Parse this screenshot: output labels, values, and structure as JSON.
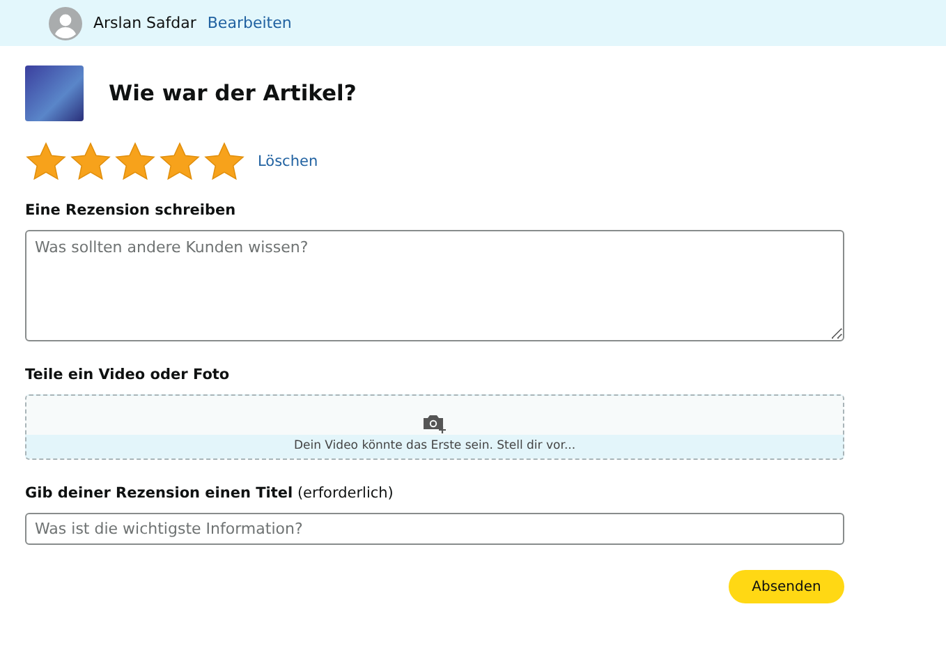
{
  "header": {
    "user_name": "Arslan Safdar",
    "edit_link": "Bearbeiten"
  },
  "product": {
    "heading": "Wie war der Artikel?"
  },
  "rating": {
    "stars": 5,
    "clear_link": "Löschen"
  },
  "review": {
    "label": "Eine Rezension schreiben",
    "placeholder": "Was sollten andere Kunden wissen?"
  },
  "media": {
    "label": "Teile ein Video oder Foto",
    "hint": "Dein Video könnte das Erste sein. Stell dir vor..."
  },
  "title_field": {
    "label": "**Gib deiner Rezension einen Titel** (erforderlich)",
    "placeholder": "Was ist die wichtigste Information?"
  },
  "submit": "Absenden"
}
